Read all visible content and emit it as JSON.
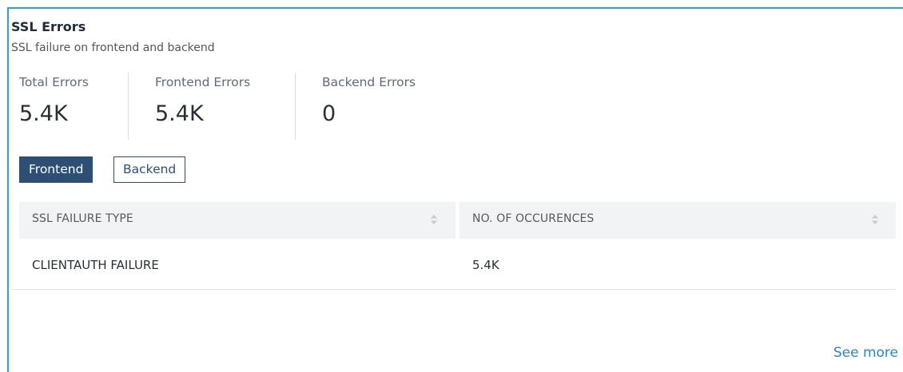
{
  "card": {
    "title": "SSL Errors",
    "subtitle": "SSL failure on frontend and backend"
  },
  "stats": [
    {
      "label": "Total Errors",
      "value": "5.4K"
    },
    {
      "label": "Frontend Errors",
      "value": "5.4K"
    },
    {
      "label": "Backend Errors",
      "value": "0"
    }
  ],
  "toggle": {
    "options": [
      "Frontend",
      "Backend"
    ],
    "selected": "Frontend"
  },
  "table": {
    "columns": [
      "SSL FAILURE TYPE",
      "NO. OF OCCURENCES"
    ],
    "rows": [
      [
        "CLIENTAUTH FAILURE",
        "5.4K"
      ]
    ]
  },
  "footer": {
    "see_more_label": "See more"
  },
  "colors": {
    "accent_border": "#2f9fe0",
    "toggle_active": "#2c4f73",
    "link": "#2a85c8"
  }
}
